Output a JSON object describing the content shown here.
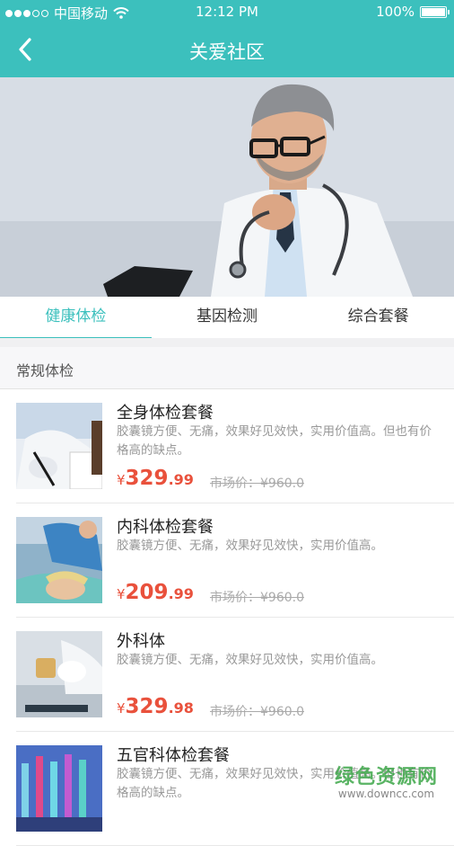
{
  "status_bar": {
    "carrier": "中国移动",
    "time": "12:12 PM",
    "battery": "100%"
  },
  "nav": {
    "title": "关爱社区",
    "back_icon": "chevron-left-icon"
  },
  "tabs": [
    {
      "label": "健康体检",
      "active": true
    },
    {
      "label": "基因检测",
      "active": false
    },
    {
      "label": "综合套餐",
      "active": false
    }
  ],
  "section_title": "常规体检",
  "packages": [
    {
      "title": "全身体检套餐",
      "desc": "胶囊镜方便、无痛，效果好见效快，实用价值高。但也有价格高的缺点。",
      "currency": "¥",
      "price_int": "329",
      "price_dec": ".99",
      "market_price": "市场价：¥960.0"
    },
    {
      "title": "内科体检套餐",
      "desc": "胶囊镜方便、无痛，效果好见效快，实用价值高。",
      "currency": "¥",
      "price_int": "209",
      "price_dec": ".99",
      "market_price": "市场价：¥960.0"
    },
    {
      "title": "外科体",
      "desc": "胶囊镜方便、无痛，效果好见效快，实用价值高。",
      "currency": "¥",
      "price_int": "329",
      "price_dec": ".98",
      "market_price": "市场价：¥960.0"
    },
    {
      "title": "五官科体检套餐",
      "desc": "胶囊镜方便、无痛，效果好见效快，实用价值高。但也有价格高的缺点。",
      "currency": "",
      "price_int": "",
      "price_dec": "",
      "market_price": ""
    }
  ],
  "watermark": {
    "main": "绿色资源网",
    "sub": "www.downcc.com"
  },
  "colors": {
    "accent": "#3cc0bd",
    "price": "#e9513c"
  }
}
